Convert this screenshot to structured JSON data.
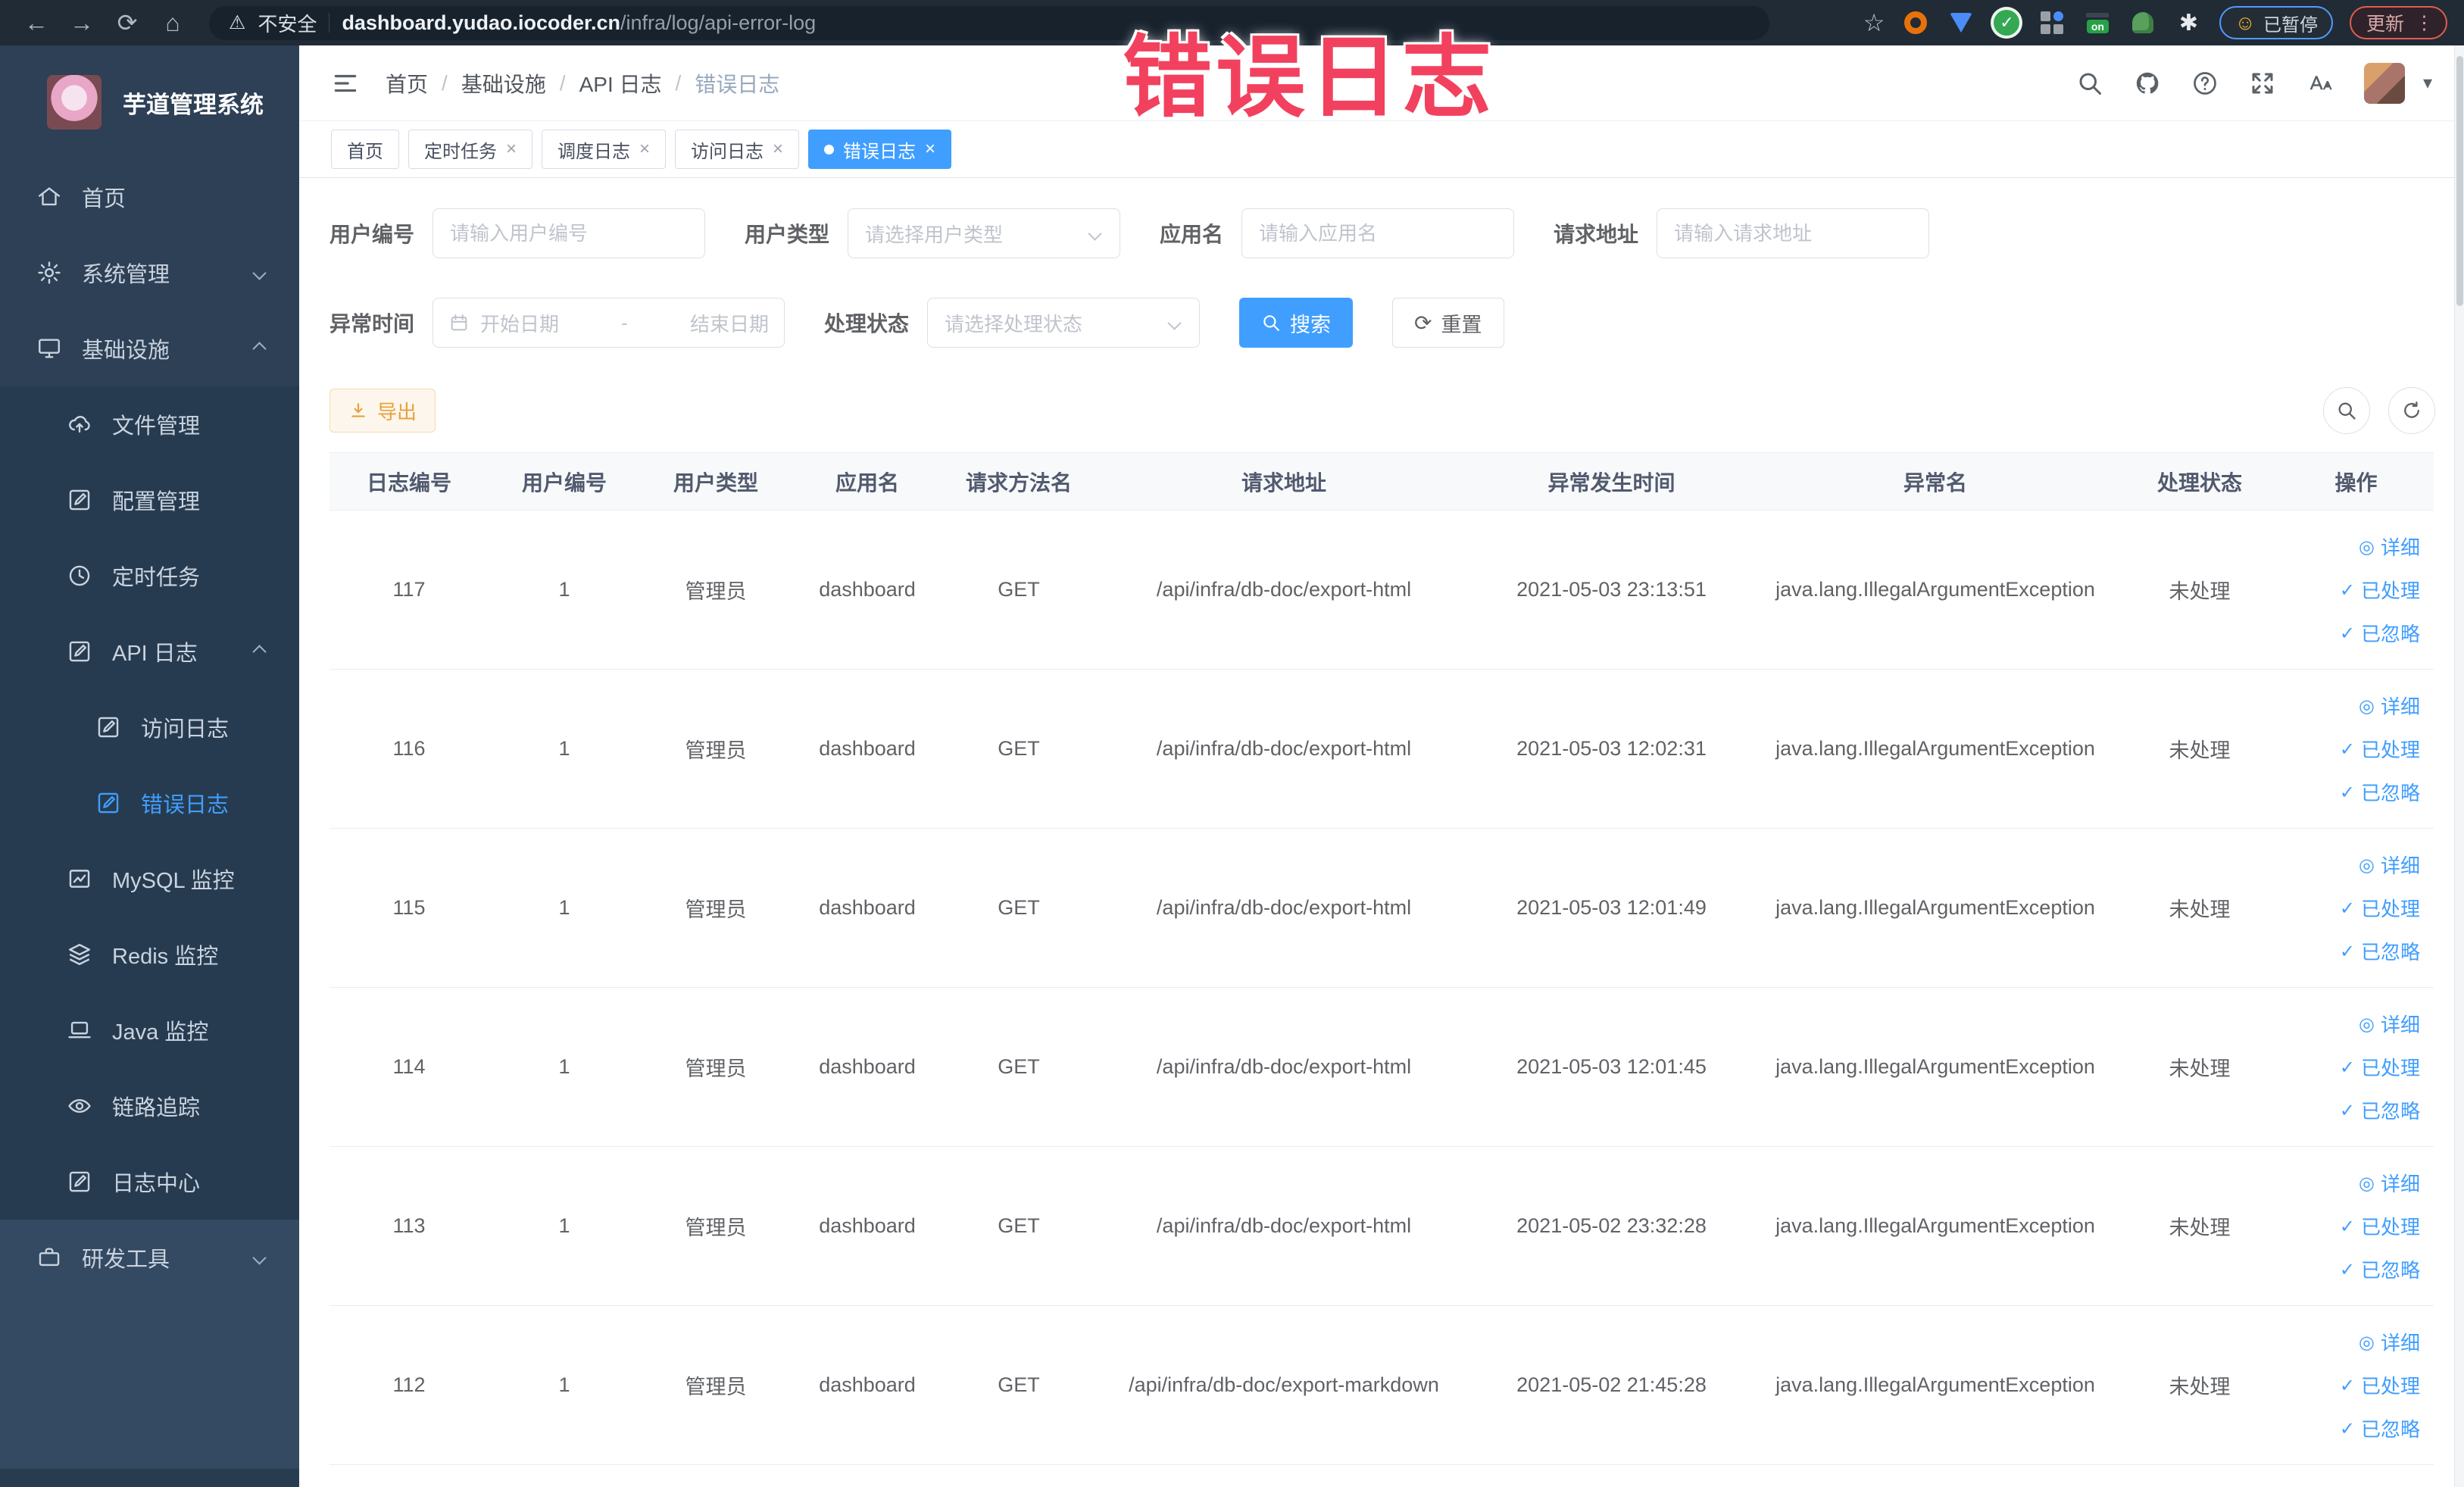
{
  "colors": {
    "accent": "#409eff",
    "warning": "#e6a23c",
    "annotation_red": "#f2415e",
    "sidebar_bg": "#2d4056",
    "browser_bar_bg": "#202b36",
    "active_tab_bg": "#409eff"
  },
  "annotation": {
    "text": "错误日志"
  },
  "browser": {
    "security_label": "不安全",
    "url_domain": "dashboard.yudao.iocoder.cn",
    "url_path": "/infra/log/api-error-log",
    "on_switch_label": "on",
    "paused_badge_label": "已暂停",
    "update_button_label": "更新",
    "extension_icons": [
      "bookmark-star-icon",
      "orange-ring-icon",
      "blue-shield-icon",
      "green-check-icon",
      "grid-icon",
      "on-switch-icon",
      "plant-icon",
      "puzzle-icon"
    ]
  },
  "sidebar": {
    "logo_title": "芋道管理系统",
    "items": [
      {
        "label": "首页",
        "icon": "home-icon"
      },
      {
        "label": "系统管理",
        "icon": "gear-icon",
        "chevron": "down"
      },
      {
        "label": "基础设施",
        "icon": "monitor-icon",
        "chevron": "up"
      },
      {
        "label": "文件管理",
        "icon": "cloud-upload-icon"
      },
      {
        "label": "配置管理",
        "icon": "edit-icon"
      },
      {
        "label": "定时任务",
        "icon": "clock-icon"
      },
      {
        "label": "API 日志",
        "icon": "log-icon",
        "chevron": "up"
      },
      {
        "label": "访问日志",
        "icon": "log-icon"
      },
      {
        "label": "错误日志",
        "icon": "log-icon",
        "active": true
      },
      {
        "label": "MySQL 监控",
        "icon": "chart-icon"
      },
      {
        "label": "Redis 监控",
        "icon": "layers-icon"
      },
      {
        "label": "Java 监控",
        "icon": "laptop-icon"
      },
      {
        "label": "链路追踪",
        "icon": "eye-icon"
      },
      {
        "label": "日志中心",
        "icon": "log-icon"
      },
      {
        "label": "研发工具",
        "icon": "toolbox-icon",
        "chevron": "down"
      }
    ]
  },
  "breadcrumb": {
    "separator": "/",
    "items": [
      "首页",
      "基础设施",
      "API 日志",
      "错误日志"
    ]
  },
  "tabsbar": {
    "close_glyph": "×",
    "tabs": [
      {
        "label": "首页",
        "closable": false,
        "active": false
      },
      {
        "label": "定时任务",
        "closable": true,
        "active": false
      },
      {
        "label": "调度日志",
        "closable": true,
        "active": false
      },
      {
        "label": "访问日志",
        "closable": true,
        "active": false
      },
      {
        "label": "错误日志",
        "closable": true,
        "active": true
      }
    ]
  },
  "filters": {
    "user_id_label": "用户编号",
    "user_id_placeholder": "请输入用户编号",
    "user_type_label": "用户类型",
    "user_type_placeholder": "请选择用户类型",
    "app_name_label": "应用名",
    "app_name_placeholder": "请输入应用名",
    "request_url_label": "请求地址",
    "request_url_placeholder": "请输入请求地址",
    "exception_time_label": "异常时间",
    "start_date_placeholder": "开始日期",
    "date_separator": "-",
    "end_date_placeholder": "结束日期",
    "process_status_label": "处理状态",
    "process_status_placeholder": "请选择处理状态",
    "search_button_label": "搜索",
    "reset_button_label": "重置"
  },
  "toolbar": {
    "export_button_label": "导出"
  },
  "table": {
    "headers": [
      "日志编号",
      "用户编号",
      "用户类型",
      "应用名",
      "请求方法名",
      "请求地址",
      "异常发生时间",
      "异常名",
      "处理状态",
      "操作"
    ],
    "action_labels": [
      "详细",
      "已处理",
      "已忽略"
    ],
    "rows": [
      {
        "log_id": "117",
        "user_id": "1",
        "user_type": "管理员",
        "app_name": "dashboard",
        "method": "GET",
        "url": "/api/infra/db-doc/export-html",
        "time": "2021-05-03 23:13:51",
        "exception": "java.lang.IllegalArgumentException",
        "status": "未处理"
      },
      {
        "log_id": "116",
        "user_id": "1",
        "user_type": "管理员",
        "app_name": "dashboard",
        "method": "GET",
        "url": "/api/infra/db-doc/export-html",
        "time": "2021-05-03 12:02:31",
        "exception": "java.lang.IllegalArgumentException",
        "status": "未处理"
      },
      {
        "log_id": "115",
        "user_id": "1",
        "user_type": "管理员",
        "app_name": "dashboard",
        "method": "GET",
        "url": "/api/infra/db-doc/export-html",
        "time": "2021-05-03 12:01:49",
        "exception": "java.lang.IllegalArgumentException",
        "status": "未处理"
      },
      {
        "log_id": "114",
        "user_id": "1",
        "user_type": "管理员",
        "app_name": "dashboard",
        "method": "GET",
        "url": "/api/infra/db-doc/export-html",
        "time": "2021-05-03 12:01:45",
        "exception": "java.lang.IllegalArgumentException",
        "status": "未处理"
      },
      {
        "log_id": "113",
        "user_id": "1",
        "user_type": "管理员",
        "app_name": "dashboard",
        "method": "GET",
        "url": "/api/infra/db-doc/export-html",
        "time": "2021-05-02 23:32:28",
        "exception": "java.lang.IllegalArgumentException",
        "status": "未处理"
      },
      {
        "log_id": "112",
        "user_id": "1",
        "user_type": "管理员",
        "app_name": "dashboard",
        "method": "GET",
        "url": "/api/infra/db-doc/export-markdown",
        "time": "2021-05-02 21:45:28",
        "exception": "java.lang.IllegalArgumentException",
        "status": "未处理"
      }
    ]
  }
}
